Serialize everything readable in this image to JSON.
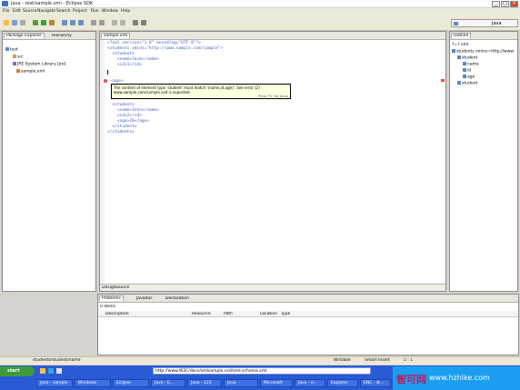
{
  "window": {
    "title": "Java - test/sample.xml - Eclipse SDK"
  },
  "menubar": {
    "items": [
      "File",
      "Edit",
      "Source",
      "Navigate",
      "Search",
      "Project",
      "Run",
      "Window",
      "Help"
    ]
  },
  "toolbar": {
    "perspective_label": "Java"
  },
  "explorer": {
    "tabs": [
      "Package Explorer",
      "Hierarchy"
    ],
    "tree": [
      "test",
      "src",
      "JRE System Library [jre]",
      "sample.xml"
    ]
  },
  "editor": {
    "tab_label": "sample.xml",
    "lines": [
      "<?xml version=\"1.0\" encoding=\"UTF-8\"?>",
      "<students xmlns=\"http://www.sample.com/sample\">",
      "  <student>",
      "    <name>Jack</name>",
      "    <id>1</id>",
      "",
      "  <student>",
      "    <name>John</name>",
      "    <id>2</id>",
      "    <age>20</age>",
      "  </student>",
      "</students>"
    ],
    "age_tag": "<age>",
    "tooltip": {
      "line1": "The content of element type 'student' must match '(name,id,age)'. See error [2]",
      "line2": "www.sample.com/sample.xsd is expected.",
      "footer": "Press 'F2' for focus"
    },
    "bottom_tabs": [
      "Design",
      "Source"
    ]
  },
  "outline": {
    "tab_label": "Outline",
    "tree": [
      "?=? xml",
      "students xmlns=http://www.",
      "student",
      "name",
      "id",
      "age",
      "student"
    ]
  },
  "problems": {
    "tabs": [
      "Problems",
      "Javadoc",
      "Declaration"
    ],
    "summary": "0 items",
    "columns": [
      "Description",
      "Resource",
      "Path",
      "Location",
      "Type"
    ]
  },
  "statusbar": {
    "path": "students/student/name",
    "writable": "Writable",
    "insert": "Smart Insert",
    "position": "5 : 1"
  },
  "taskbar": {
    "start": "start",
    "address": "http://www.W3C/docs/xmlsample.xsd/xml-schema.xml",
    "tasks": [
      "Java - sample",
      "Windows",
      "Eclipse",
      "Java - E...",
      "Java - 123",
      "Java",
      "Microsoft",
      "Java - e..",
      "Explorer",
      "ENC - st..."
    ],
    "brand": "智可网",
    "brand_url": "www.hzhike.com"
  }
}
